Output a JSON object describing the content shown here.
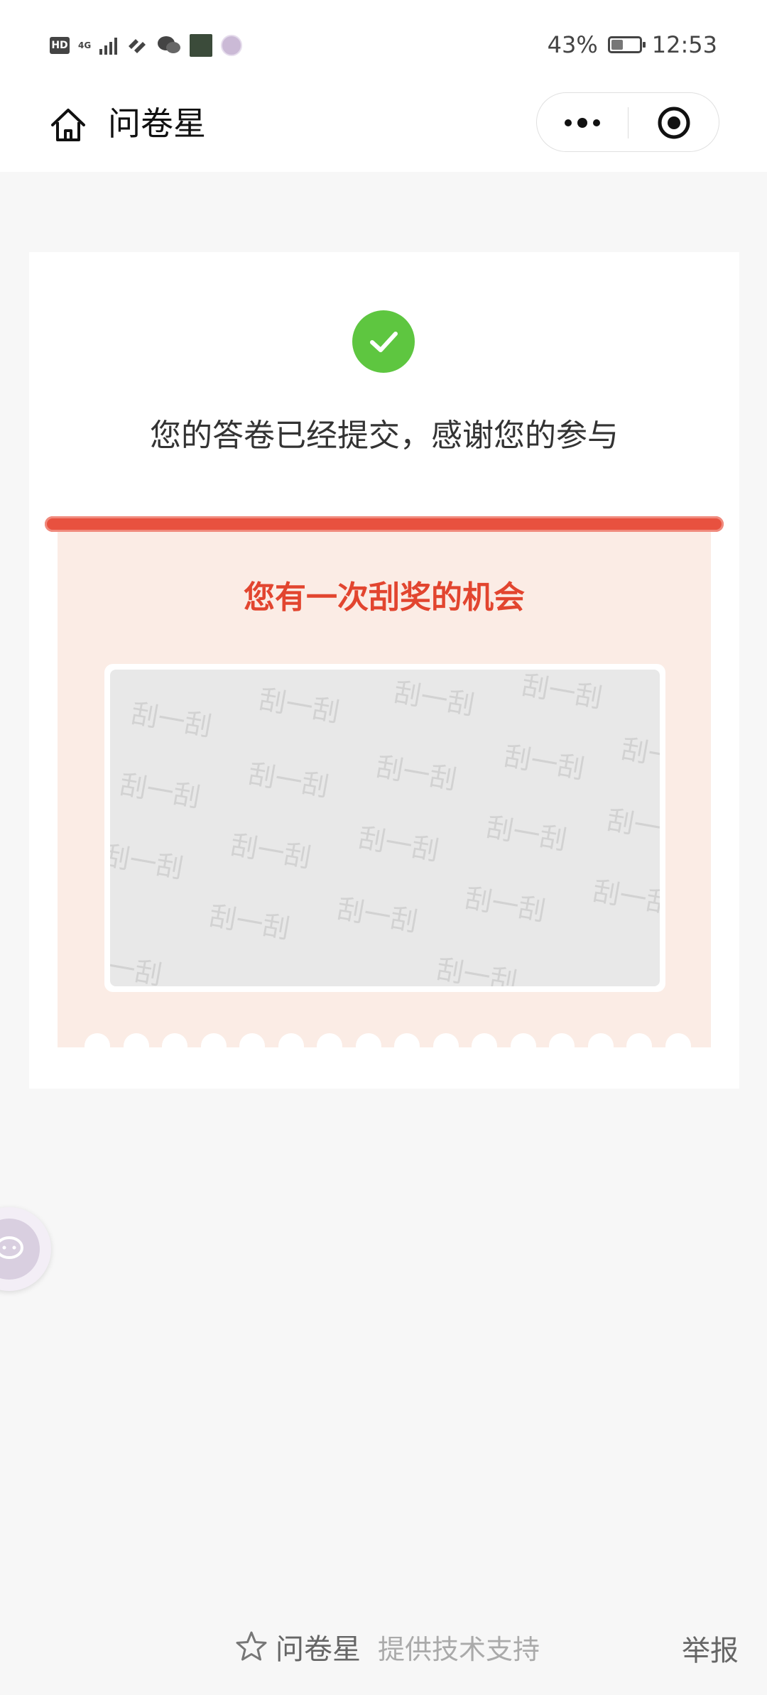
{
  "status_bar": {
    "hd": "HD",
    "network": "4G",
    "battery_percent": "43%",
    "battery_level": 0.43,
    "time": "12:53"
  },
  "nav": {
    "title": "问卷星",
    "icons": {
      "home": "home-icon",
      "more": "more-dots-icon",
      "close": "close-circle-icon"
    }
  },
  "result": {
    "message": "您的答卷已经提交，感谢您的参与",
    "success_color": "#5ec640"
  },
  "lottery": {
    "title": "您有一次刮奖的机会",
    "scratch_text": "刮一刮",
    "accent_color": "#e2452f"
  },
  "footer": {
    "brand": "问卷星",
    "support": "提供技术支持",
    "report": "举报"
  }
}
